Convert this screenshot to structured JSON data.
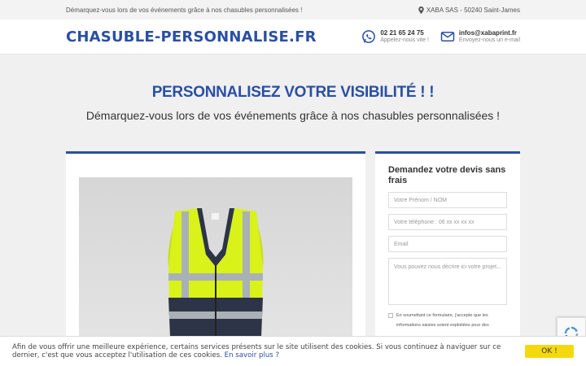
{
  "topbar": {
    "tagline": "Démarquez-vous lors de vos événements grâce à nos chasubles personnalisées !",
    "location": "XABA SAS - 50240 Saint-James"
  },
  "header": {
    "brand": "CHASUBLE-PERSONNALISE.FR",
    "phone": {
      "number": "02 21 65 24 75",
      "label": "Appelez-nous vite !",
      "icon": "whatsapp-icon"
    },
    "email": {
      "address": "infos@xabaprint.fr",
      "label": "Envoyez-nous un e-mail",
      "icon": "mail-icon"
    }
  },
  "hero": {
    "title": "PERSONNALISEZ VOTRE VISIBILITÉ ! !",
    "subtitle": "Démarquez-vous lors de vos événements grâce à nos chasubles personnalisées !"
  },
  "form": {
    "title": "Demandez votre devis sans frais",
    "name_placeholder": "Votre Prénom / NOM",
    "phone_placeholder": "Votre téléphone : 06 xx xx xx xx",
    "email_placeholder": "Email",
    "message_placeholder": "Vous pouvez nous décrire ici votre projet...",
    "consent_text": "En soumettant ce formulaire, j'accepte que les informations saisies soient exploitées pour des"
  },
  "cookie": {
    "message": "Afin de vous offrir une meilleure expérience, certains services présents sur le site utilisent des cookies. Si vous continuez à naviguer sur ce dernier, c'est que vous acceptez l'utilisation de ces cookies.",
    "link": "En savoir plus ?",
    "ok_label": "OK !"
  },
  "colors": {
    "brand": "#2a4fa4",
    "vest_yellow": "#d8f21a",
    "vest_dark": "#2e3447",
    "ok_button": "#f5d90f"
  }
}
